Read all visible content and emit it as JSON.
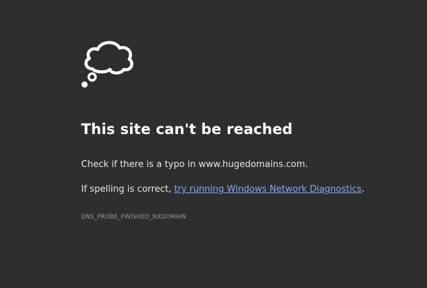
{
  "icon": {
    "name": "sad-cloud-icon",
    "color": "#ffffff"
  },
  "error": {
    "title": "This site can't be reached",
    "message_line1": "Check if there is a typo in www.hugedomains.com.",
    "message_line2_prefix": "If spelling is correct, ",
    "diagnostics_link": "try running Windows Network Diagnostics",
    "message_line2_suffix": ".",
    "code": "DNS_PROBE_FINISHED_NXDOMAIN"
  },
  "colors": {
    "background": "#2e2e2e",
    "link": "#7cacf8",
    "code_text": "#9a9a9a"
  }
}
